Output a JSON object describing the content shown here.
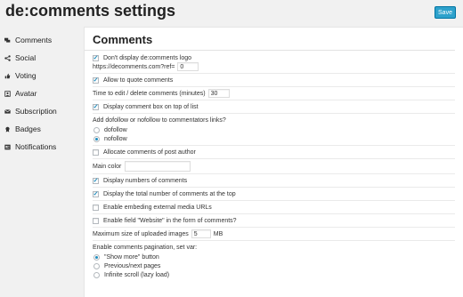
{
  "header": {
    "title": "de:comments settings",
    "save_label": "Save"
  },
  "sidebar": {
    "items": [
      {
        "label": "Comments",
        "icon": "comments-icon"
      },
      {
        "label": "Social",
        "icon": "share-icon"
      },
      {
        "label": "Voting",
        "icon": "voting-icon"
      },
      {
        "label": "Avatar",
        "icon": "avatar-icon"
      },
      {
        "label": "Subscription",
        "icon": "envelope-icon"
      },
      {
        "label": "Badges",
        "icon": "badge-icon"
      },
      {
        "label": "Notifications",
        "icon": "notifications-icon"
      }
    ]
  },
  "panel": {
    "title": "Comments",
    "dont_display_logo": {
      "label": "Don't display de:comments logo",
      "checked": true
    },
    "ref_label": "https://decomments.com?ref=",
    "ref_value": "0",
    "allow_quote": {
      "label": "Allow to quote comments",
      "checked": true
    },
    "edit_time_label": "Time to edit / delete comments (minutes)",
    "edit_time_value": "30",
    "display_on_top": {
      "label": "Display comment box on top of list",
      "checked": true
    },
    "follow_question": "Add dofollow or nofollow to commentators links?",
    "follow_options": [
      {
        "label": "dofollow",
        "checked": false
      },
      {
        "label": "nofollow",
        "checked": true
      }
    ],
    "allocate_author": {
      "label": "Allocate comments of post author",
      "checked": false
    },
    "main_color_label": "Main color",
    "main_color_value": "",
    "display_numbers": {
      "label": "Display numbers of comments",
      "checked": true
    },
    "display_total": {
      "label": "Display the total number of comments at the top",
      "checked": true
    },
    "embed_media": {
      "label": "Enable embeding external media URLs",
      "checked": false
    },
    "website_field": {
      "label": "Enable field \"Website\" in the form of comments?",
      "checked": false
    },
    "max_upload_label": "Maximum size of uploaded images",
    "max_upload_value": "5",
    "max_upload_unit": "MB",
    "pagination_question": "Enable comments pagination, set var:",
    "pagination_options": [
      {
        "label": "\"Show more\" button",
        "checked": true
      },
      {
        "label": "Previous/next pages",
        "checked": false
      },
      {
        "label": "Infinite scroll (lazy load)",
        "checked": false
      }
    ]
  },
  "colors": {
    "accent": "#2ea2cc",
    "background": "#f1f1f1",
    "panel": "#ffffff"
  }
}
